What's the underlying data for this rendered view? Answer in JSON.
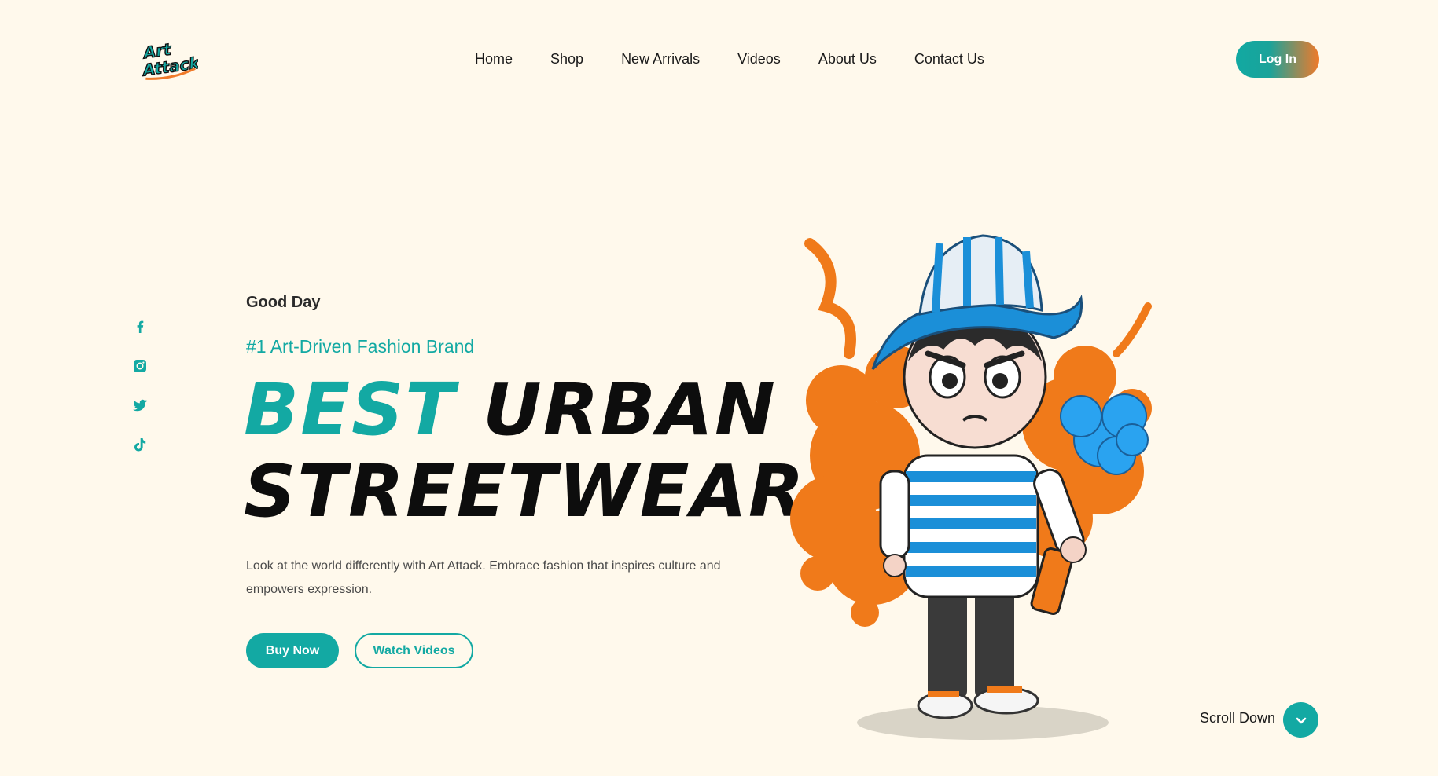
{
  "brand": {
    "logo_text_line1": "Art",
    "logo_text_line2": "Attack",
    "colors": {
      "accent": "#13a9a3",
      "orange": "#f07a2a",
      "background": "#fff9ec"
    }
  },
  "nav": {
    "items": [
      {
        "label": "Home"
      },
      {
        "label": "Shop"
      },
      {
        "label": "New Arrivals"
      },
      {
        "label": "Videos"
      },
      {
        "label": "About Us"
      },
      {
        "label": "Contact Us"
      }
    ],
    "login_label": "Log In"
  },
  "social": {
    "icons": [
      "facebook-icon",
      "instagram-icon",
      "twitter-icon",
      "tiktok-icon"
    ]
  },
  "hero": {
    "greeting": "Good Day",
    "tagline": "#1 Art-Driven Fashion Brand",
    "headline_word1": "BEST",
    "headline_word2": "URBAN",
    "headline_line2": "STREETWEAR",
    "description": "Look at the world differently with Art Attack. Embrace fashion that inspires culture and empowers expression.",
    "buy_label": "Buy Now",
    "watch_label": "Watch Videos"
  },
  "scroll": {
    "label": "Scroll Down",
    "icon": "chevron-down-icon"
  }
}
